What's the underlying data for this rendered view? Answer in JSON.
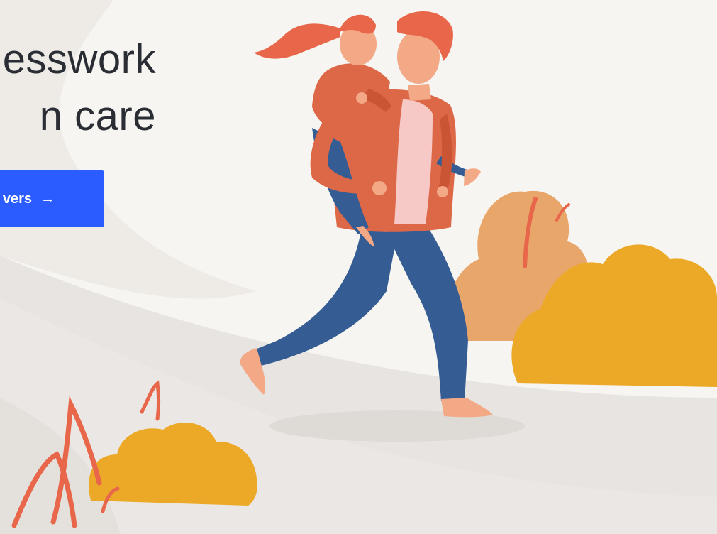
{
  "hero": {
    "headline_line1": "esswork",
    "headline_line2": "n care",
    "cta_label": "vers",
    "cta_icon": "arrow-right-icon"
  },
  "colors": {
    "background": "#f7f5f1",
    "cta": "#2a5cff",
    "headline": "#2a2d33",
    "jacket": "#dd6847",
    "jeans": "#355d94",
    "bush_yellow": "#eca928",
    "bush_peach": "#e9a66a",
    "grass": "#e8664a"
  }
}
